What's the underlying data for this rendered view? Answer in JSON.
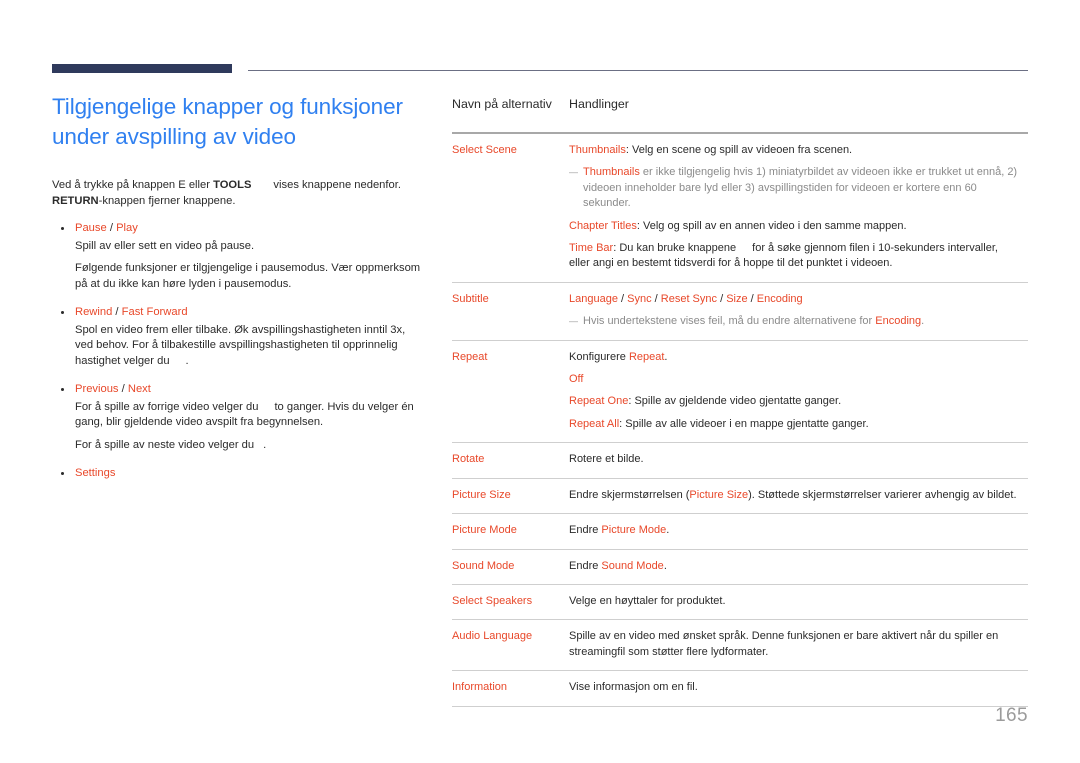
{
  "document": {
    "page_number": "165",
    "colors": {
      "heading_blue": "#3080f0",
      "term_orange": "#e8482a",
      "rule_navy": "#2f3a5c",
      "note_gray": "#8b8b8b",
      "page_number_gray": "#9b9b9b"
    }
  },
  "heading": {
    "title": "Tilgjengelige knapper og funksjoner under avspilling av video"
  },
  "intro": {
    "line1_a": "Ved å trykke på knappen E eller ",
    "line1_tools": "TOOLS",
    "line1_b": "vises knappene nedenfor.",
    "line2_return": "RETURN",
    "line2_b": "-knappen fjerner knappene."
  },
  "bullets": [
    {
      "title_parts": [
        "Pause",
        " / ",
        "Play"
      ],
      "body": [
        "Spill av eller sett en video på pause.",
        "Følgende funksjoner er tilgjengelige i pausemodus. Vær oppmerksom på at du ikke kan høre lyden i pausemodus."
      ]
    },
    {
      "title_parts": [
        "Rewind",
        " / ",
        "Fast Forward"
      ],
      "body_a": "Spol en video frem eller tilbake. Øk avspillingshastigheten inntil 3x, ved behov. For å tilbakestille avspillingshastigheten til opprinnelig hastighet velger du",
      "body_b": "."
    },
    {
      "title_parts": [
        "Previous",
        " / ",
        "Next"
      ],
      "body_a": "For å spille av forrige video velger du",
      "body_b": "to ganger. Hvis du velger én gang, blir gjeldende video avspilt fra begynnelsen.",
      "body_c": "For å spille av neste video velger du",
      "body_d": "."
    },
    {
      "title_parts": [
        "Settings",
        "",
        ""
      ],
      "body": []
    }
  ],
  "table": {
    "header": {
      "col1": "Navn på alternativ",
      "col2": "Handlinger"
    },
    "rows": [
      {
        "name": "Select Scene",
        "lines": [
          {
            "kind": "line",
            "term": "Thumbnails",
            "rest": ": Velg en scene og spill av videoen fra scenen."
          },
          {
            "kind": "note",
            "term": "Thumbnails",
            "rest": " er ikke tilgjengelig hvis 1) miniatyrbildet av videoen ikke er trukket ut ennå, 2) videoen inneholder bare lyd eller 3) avspillingstiden for videoen er kortere enn 60 sekunder."
          },
          {
            "kind": "line",
            "term": "Chapter Titles",
            "rest": ": Velg og spill av en annen video i den samme mappen."
          },
          {
            "kind": "timebar",
            "term": "Time Bar",
            "rest_a": ": Du kan bruke knappene",
            "rest_b": "for å søke gjennom filen i 10-sekunders intervaller, eller angi en bestemt tidsverdi for å hoppe til det punktet i videoen."
          }
        ]
      },
      {
        "name": "Subtitle",
        "lines": [
          {
            "kind": "terms",
            "terms": [
              "Language",
              "Sync",
              "Reset Sync",
              "Size",
              "Encoding"
            ]
          },
          {
            "kind": "note_mid",
            "pre": "Hvis undertekstene vises feil, må du endre alternativene for ",
            "term": "Encoding",
            "post": "."
          }
        ]
      },
      {
        "name": "Repeat",
        "lines": [
          {
            "kind": "pre_term",
            "pre": "Konfigurere ",
            "term": "Repeat",
            "post": "."
          },
          {
            "kind": "only_term",
            "term": "Off"
          },
          {
            "kind": "line",
            "term": "Repeat One",
            "rest": ": Spille av gjeldende video gjentatte ganger."
          },
          {
            "kind": "line",
            "term": "Repeat All",
            "rest": ": Spille av alle videoer i en mappe gjentatte ganger."
          }
        ]
      },
      {
        "name": "Rotate",
        "lines": [
          {
            "kind": "plain",
            "text": "Rotere et bilde."
          }
        ]
      },
      {
        "name": "Picture Size",
        "lines": [
          {
            "kind": "mid_term",
            "pre": "Endre skjermstørrelsen (",
            "term": "Picture Size",
            "post": "). Støttede skjermstørrelser varierer avhengig av bildet."
          }
        ]
      },
      {
        "name": "Picture Mode",
        "lines": [
          {
            "kind": "pre_term",
            "pre": "Endre ",
            "term": "Picture Mode",
            "post": "."
          }
        ]
      },
      {
        "name": "Sound Mode",
        "lines": [
          {
            "kind": "pre_term",
            "pre": "Endre ",
            "term": "Sound Mode",
            "post": "."
          }
        ]
      },
      {
        "name": "Select Speakers",
        "lines": [
          {
            "kind": "plain",
            "text": "Velge en høyttaler for produktet."
          }
        ]
      },
      {
        "name": "Audio Language",
        "lines": [
          {
            "kind": "plain",
            "text": "Spille av en video med ønsket språk. Denne funksjonen er bare aktivert når du spiller en streamingfil som støtter flere lydformater."
          }
        ]
      },
      {
        "name": "Information",
        "lines": [
          {
            "kind": "plain",
            "text": "Vise informasjon om en fil."
          }
        ]
      }
    ]
  }
}
